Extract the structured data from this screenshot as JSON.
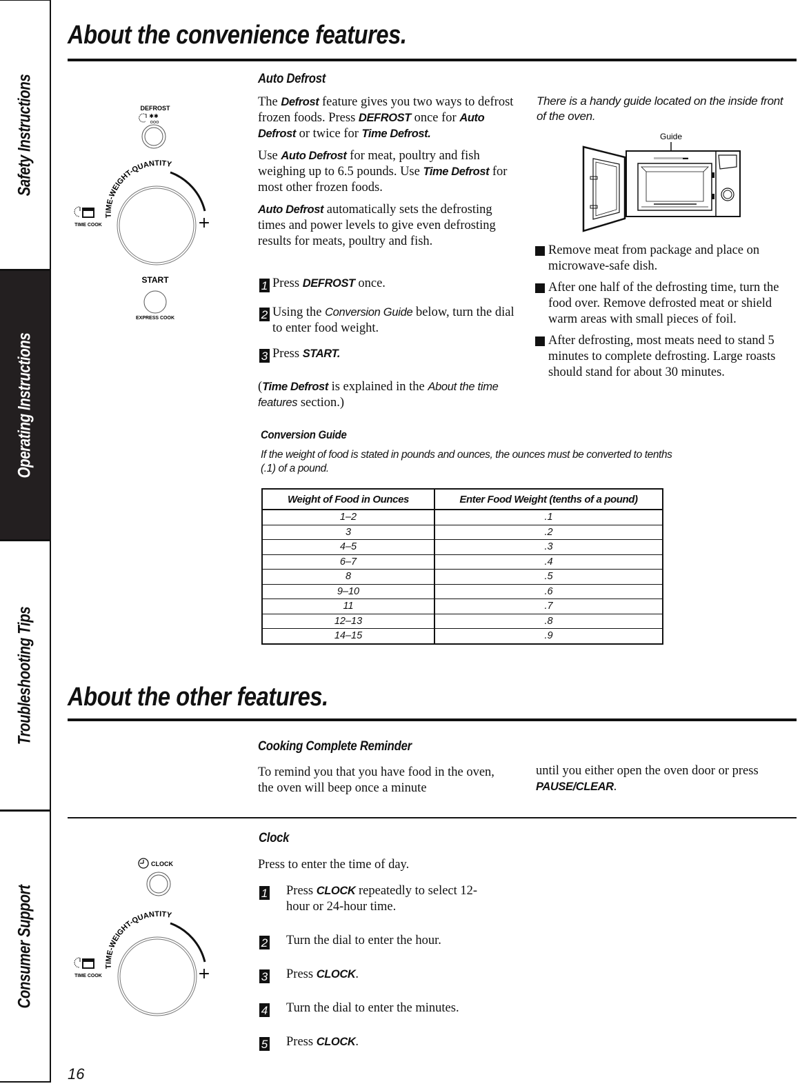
{
  "sidebar": {
    "tabs": [
      {
        "label": "Safety Instructions",
        "active": false
      },
      {
        "label": "Operating Instructions",
        "active": true
      },
      {
        "label": "Troubleshooting Tips",
        "active": false
      },
      {
        "label": "Consumer Support",
        "active": false
      }
    ]
  },
  "convenience": {
    "title": "About the convenience features.",
    "panel": {
      "defrost_label": "DEFROST",
      "dial_label": "TIME-WEIGHT-QUANTITY",
      "time_cook_label": "TIME COOK",
      "plus": "+",
      "start_label": "START",
      "express_cook_label": "EXPRESS COOK"
    },
    "auto_defrost": {
      "heading": "Auto Defrost",
      "p1": {
        "a": "The ",
        "b": "Defrost",
        "c": " feature gives you two ways to defrost frozen foods. Press ",
        "d": "DEFROST",
        "e": " once for ",
        "f": "Auto Defrost",
        "g": " or twice for ",
        "h": "Time Defrost."
      },
      "p2": {
        "a": "Use ",
        "b": "Auto Defrost",
        "c": "  for meat, poultry and fish weighing up to 6.5 pounds. Use ",
        "d": "Time Defrost",
        "e": "  for most other frozen foods."
      },
      "p3": {
        "a": "Auto Defrost",
        "b": "  automatically sets the defrosting times and power levels to give even defrosting results for meats, poultry and fish."
      },
      "steps": [
        {
          "num": "1",
          "a": "Press ",
          "b": "DEFROST",
          "c": " once."
        },
        {
          "num": "2",
          "a": "Using the ",
          "b": "Conversion Guide",
          "c": " below, turn the dial to enter food weight."
        },
        {
          "num": "3",
          "a": "Press ",
          "b": "START.",
          "c": ""
        }
      ],
      "note": {
        "a": "(",
        "b": "Time Defrost",
        "c": "  is explained in the ",
        "d": "About the time features",
        "e": " section.)"
      }
    },
    "guide_note": "There is a handy guide located on the inside front of the oven.",
    "guide_callout": "Guide",
    "tips": [
      "Remove meat from package and place on microwave-safe dish.",
      "After one half of the defrosting time, turn the food over. Remove defrosted meat or shield warm areas with small pieces of foil.",
      "After defrosting, most meats need to stand 5 minutes to complete defrosting. Large roasts should stand for about 30 minutes."
    ],
    "conversion_guide": {
      "heading": "Conversion Guide",
      "description": "If the weight of food is stated in pounds and ounces, the ounces must be converted to tenths (.1) of a pound.",
      "columns": [
        "Weight of Food in Ounces",
        "Enter Food Weight (tenths of a pound)"
      ],
      "rows": [
        [
          "1–2",
          ".1"
        ],
        [
          "3",
          ".2"
        ],
        [
          "4–5",
          ".3"
        ],
        [
          "6–7",
          ".4"
        ],
        [
          "8",
          ".5"
        ],
        [
          "9–10",
          ".6"
        ],
        [
          "11",
          ".7"
        ],
        [
          "12–13",
          ".8"
        ],
        [
          "14–15",
          ".9"
        ]
      ]
    }
  },
  "other": {
    "title": "About the other features.",
    "reminder": {
      "heading": "Cooking Complete Reminder",
      "col1": "To remind you that you have food in the oven, the oven will beep once a minute",
      "col2_a": "until you either open the oven door or press ",
      "col2_b": "PAUSE/CLEAR",
      "col2_c": "."
    },
    "clock": {
      "heading": "Clock",
      "intro": "Press to enter the time of day.",
      "panel": {
        "clock_label": "CLOCK",
        "dial_label": "TIME-WEIGHT-QUANTITY",
        "time_cook_label": "TIME COOK",
        "plus": "+"
      },
      "steps": [
        {
          "num": "1",
          "a": "Press ",
          "b": "CLOCK",
          "c": " repeatedly to select 12-hour or 24-hour time."
        },
        {
          "num": "2",
          "a": "Turn the dial to enter the hour.",
          "b": "",
          "c": ""
        },
        {
          "num": "3",
          "a": "Press ",
          "b": "CLOCK",
          "c": "."
        },
        {
          "num": "4",
          "a": "Turn the dial to enter the minutes.",
          "b": "",
          "c": ""
        },
        {
          "num": "5",
          "a": "Press ",
          "b": "CLOCK",
          "c": "."
        }
      ]
    }
  },
  "page_number": "16"
}
